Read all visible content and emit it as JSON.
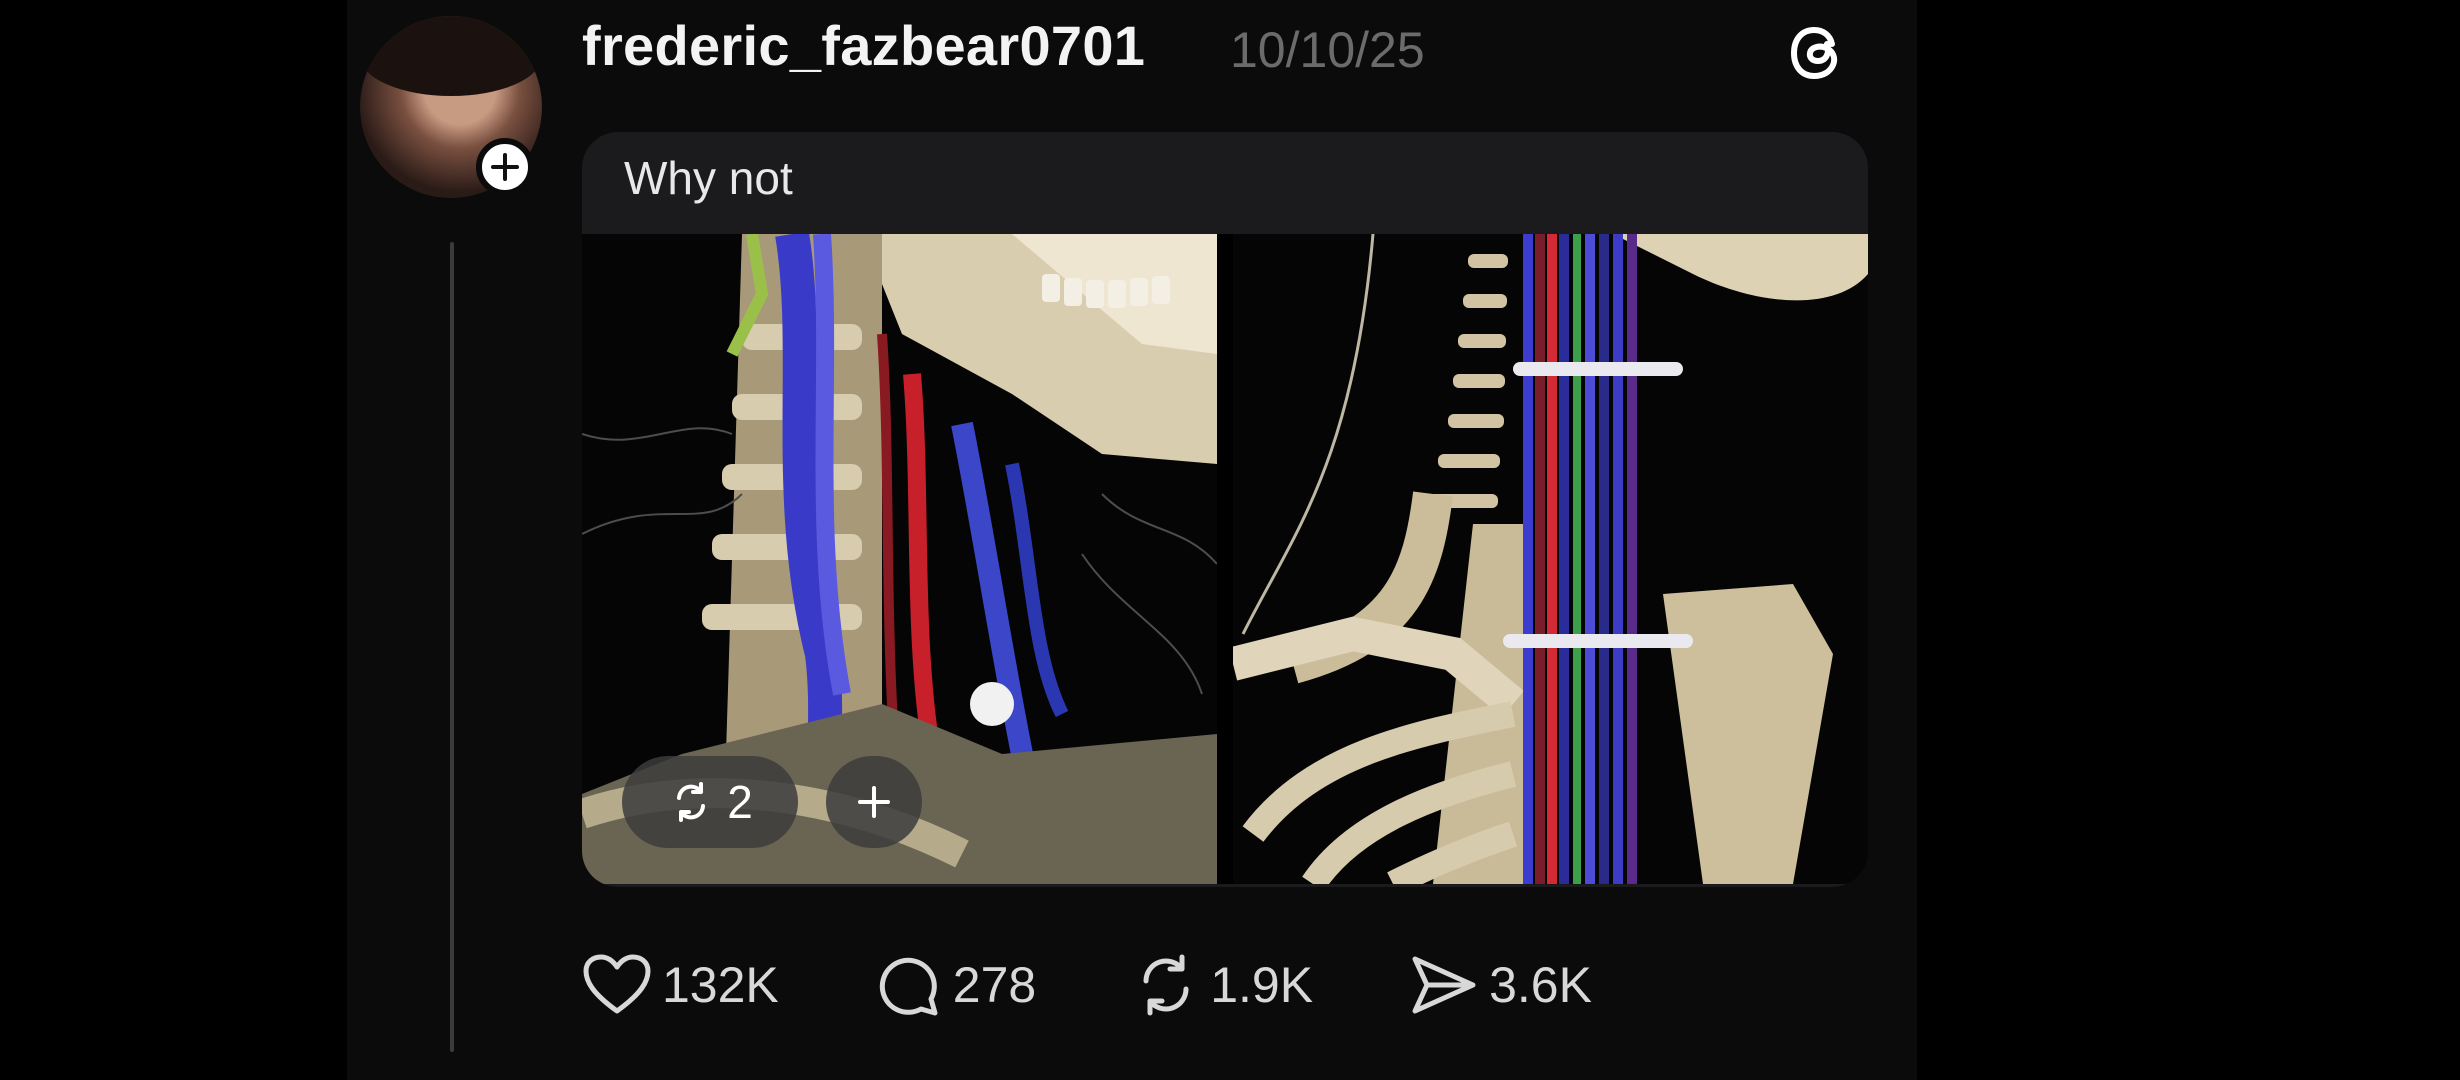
{
  "post": {
    "username": "frederic_fazbear0701",
    "date": "10/10/25",
    "caption": "Why not",
    "media_overlay": {
      "repost_count": "2"
    }
  },
  "actions": {
    "likes": "132K",
    "comments": "278",
    "reposts": "1.9K",
    "shares": "3.6K"
  },
  "icons": {
    "platform": "threads-logo-icon",
    "follow": "plus-icon",
    "like": "heart-icon",
    "comment": "comment-bubble-icon",
    "repost": "repost-icon",
    "share": "send-icon"
  },
  "colors": {
    "background": "#000000",
    "card": "#0b0b0b",
    "caption_bubble": "#1b1b1d",
    "text_primary": "#f3f3f3",
    "text_muted": "#6b6b6b"
  }
}
